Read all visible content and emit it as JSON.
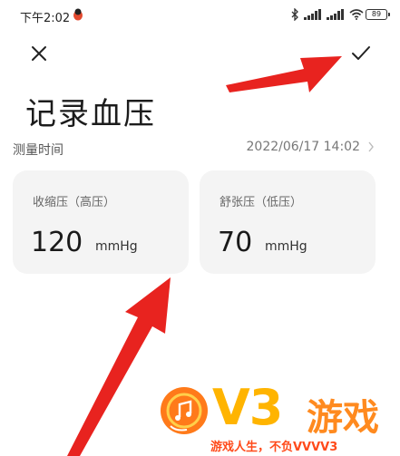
{
  "status_bar": {
    "time": "下午2:02",
    "icons": [
      "bluetooth-icon",
      "signal-icon",
      "signal-icon",
      "wifi-icon"
    ],
    "battery": "89"
  },
  "toolbar": {
    "close_icon": "close-icon",
    "confirm_icon": "check-icon"
  },
  "page": {
    "title": "记录血压"
  },
  "measure_time": {
    "label": "测量时间",
    "value": "2022/06/17 14:02"
  },
  "systolic": {
    "label": "收缩压（高压）",
    "value": "120",
    "unit": "mmHg"
  },
  "diastolic": {
    "label": "舒张压（低压）",
    "value": "70",
    "unit": "mmHg"
  },
  "watermark": {
    "brand": "V3",
    "name": "游戏",
    "slogan": "游戏人生，不负VVVV3"
  },
  "colors": {
    "arrow": "#e8231f",
    "card_bg": "#f4f4f4",
    "logo_yellow": "#ffb400",
    "logo_orange": "#ff8a1f"
  }
}
